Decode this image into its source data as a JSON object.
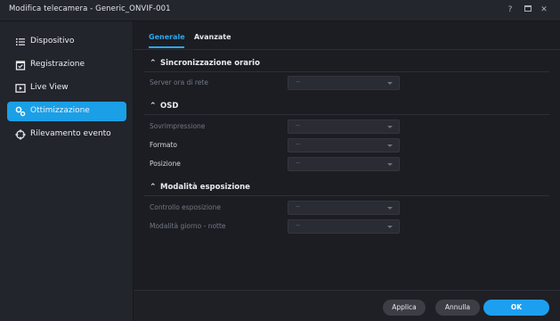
{
  "window": {
    "title": "Modifica telecamera - Generic_ONVIF-001",
    "help_label": "?",
    "close_label": "✕"
  },
  "sidebar": {
    "items": [
      {
        "label": "Dispositivo",
        "icon": "list-icon",
        "active": false
      },
      {
        "label": "Registrazione",
        "icon": "calendar-icon",
        "active": false
      },
      {
        "label": "Live View",
        "icon": "play-icon",
        "active": false
      },
      {
        "label": "Ottimizzazione",
        "icon": "gears-icon",
        "active": true
      },
      {
        "label": "Rilevamento evento",
        "icon": "crosshair-icon",
        "active": false
      }
    ]
  },
  "tabs": [
    {
      "label": "Generale",
      "active": true
    },
    {
      "label": "Avanzate",
      "active": false
    }
  ],
  "sections": [
    {
      "title": "Sincronizzazione orario",
      "rows": [
        {
          "label": "Server ora di rete",
          "value": "--",
          "enabled": false
        }
      ]
    },
    {
      "title": "OSD",
      "rows": [
        {
          "label": "Sovrimpressione",
          "value": "--",
          "enabled": false
        },
        {
          "label": "Formato",
          "value": "--",
          "enabled": true
        },
        {
          "label": "Posizione",
          "value": "--",
          "enabled": true
        }
      ]
    },
    {
      "title": "Modalità esposizione",
      "rows": [
        {
          "label": "Controllo esposizione",
          "value": "--",
          "enabled": false
        },
        {
          "label": "Modalità giorno - notte",
          "value": "--",
          "enabled": false
        }
      ]
    }
  ],
  "footer": {
    "apply_label": "Applica",
    "cancel_label": "Annulla",
    "ok_label": "OK"
  },
  "colors": {
    "accent": "#1b9fe6",
    "background": "#1b1d22",
    "sidebar": "#22252b"
  }
}
